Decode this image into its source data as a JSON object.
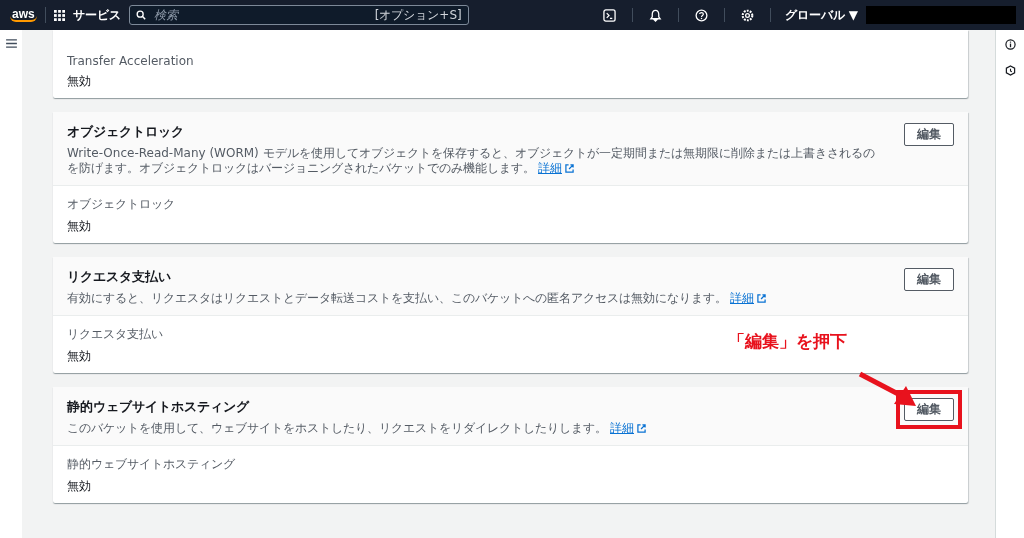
{
  "top_bar": {
    "logo": "aws",
    "services": "サービス",
    "search": {
      "placeholder": "検索",
      "shortcut": "[オプション+S]"
    },
    "region": "グローバル ▼"
  },
  "cards": [
    {
      "partial": true,
      "field_label": "Transfer Acceleration",
      "field_value": "無効"
    },
    {
      "partial": false,
      "title": "オブジェクトロック",
      "edit": "編集",
      "description": "Write-Once-Read-Many (WORM) モデルを使用してオブジェクトを保存すると、オブジェクトが一定期間または無期限に削除または上書きされるのを防げます。オブジェクトロックはバージョニングされたバケットでのみ機能します。",
      "link": "詳細",
      "field_label": "オブジェクトロック",
      "field_value": "無効"
    },
    {
      "partial": false,
      "title": "リクエスタ支払い",
      "edit": "編集",
      "description": "有効にすると、リクエスタはリクエストとデータ転送コストを支払い、このバケットへの匿名アクセスは無効になります。",
      "link": "詳細",
      "field_label": "リクエスタ支払い",
      "field_value": "無効"
    },
    {
      "partial": false,
      "title": "静的ウェブサイトホスティング",
      "edit": "編集",
      "description": "このバケットを使用して、ウェブサイトをホストしたり、リクエストをリダイレクトしたりします。",
      "link": "詳細",
      "field_label": "静的ウェブサイトホスティング",
      "field_value": "無効",
      "highlighted": true
    }
  ],
  "annotation": {
    "text": "「編集」を押下"
  }
}
